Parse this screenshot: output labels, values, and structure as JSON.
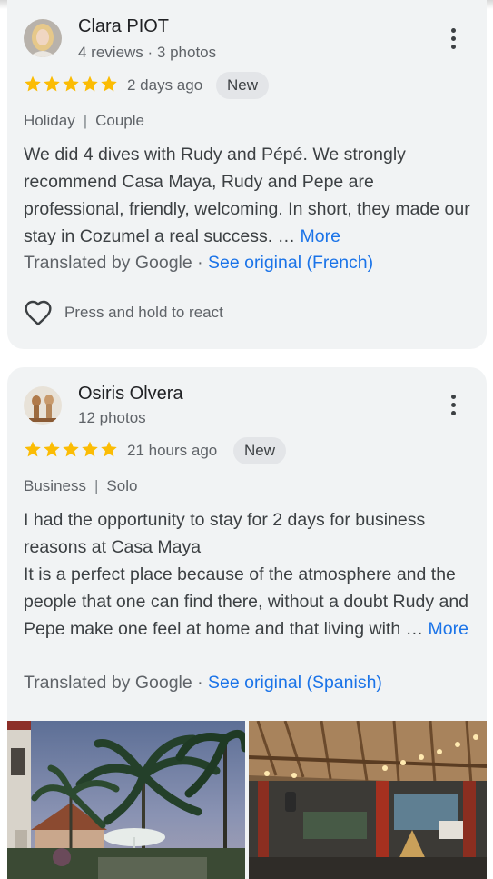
{
  "reviews": [
    {
      "name": "Clara PIOT",
      "meta": "4 reviews · 3 photos",
      "rating": 5,
      "time": "2 days ago",
      "badge": "New",
      "tag1": "Holiday",
      "tag_sep": "|",
      "tag2": "Couple",
      "text": "We did 4 dives with Rudy and Pépé. We strongly recommend Casa Maya, Rudy and Pepe are professional, friendly, welcoming. In short, they made our stay in Cozumel a real success. …",
      "more": "More",
      "translated_prefix": "Translated by Google · ",
      "see_original": "See original (French)",
      "react_label": "Press and hold to react"
    },
    {
      "name": "Osiris Olvera",
      "meta": "12 photos",
      "rating": 5,
      "time": "21 hours ago",
      "badge": "New",
      "tag1": "Business",
      "tag_sep": "|",
      "tag2": "Solo",
      "text_p1": "I had the opportunity to stay for 2 days for business reasons at Casa Maya",
      "text_p2": "It is a perfect place because of the atmosphere and the people that one can find there, without a doubt Rudy and Pepe make one feel at home and that living with …",
      "more": "More",
      "translated_prefix": "Translated by Google · ",
      "see_original": "See original (Spanish)"
    }
  ],
  "colors": {
    "star": "#fbbc04",
    "link": "#1a73e8",
    "card_bg": "#f1f3f4"
  },
  "icons": {
    "menu": "more-vert-icon",
    "react": "heart-outline-icon",
    "star": "star-filled-icon"
  }
}
